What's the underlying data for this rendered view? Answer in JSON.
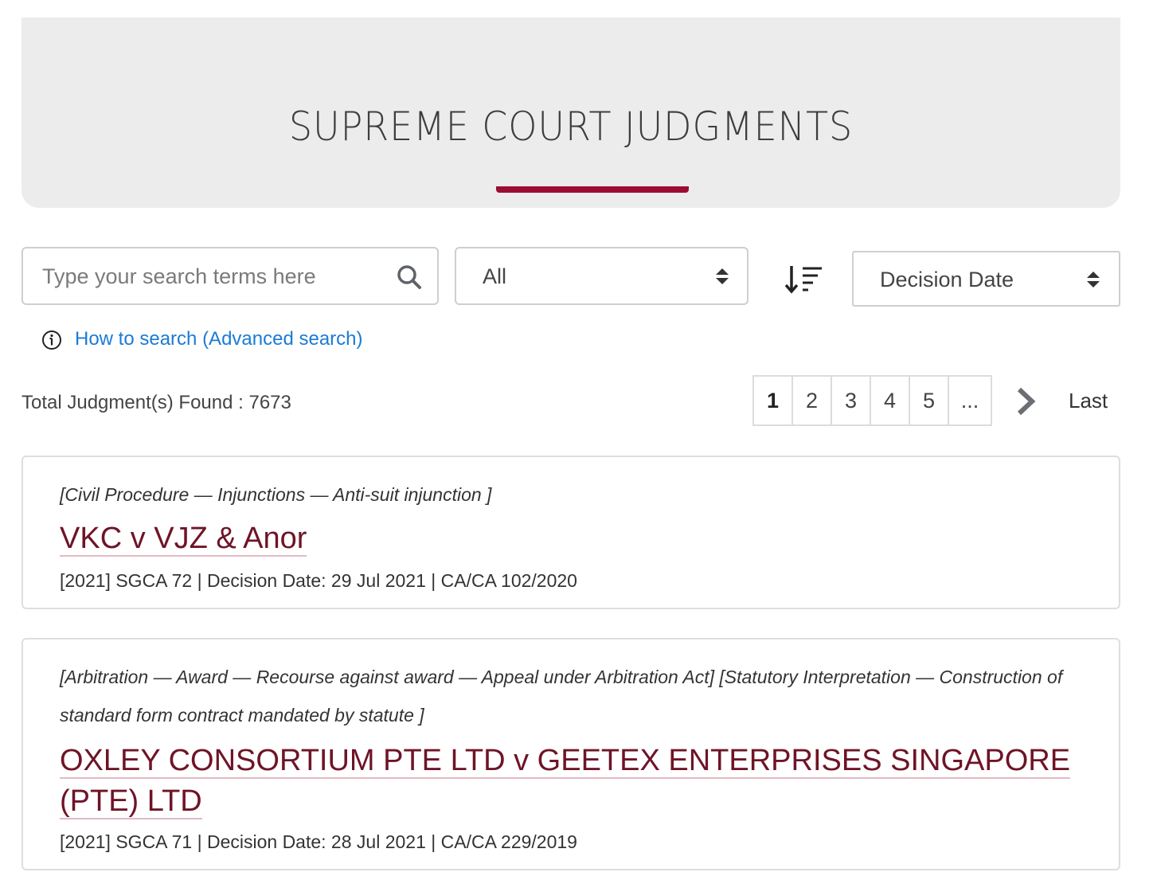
{
  "header": {
    "title": "SUPREME COURT JUDGMENTS",
    "accent_color": "#9b0d35"
  },
  "search": {
    "placeholder": "Type your search terms here",
    "value": "",
    "icon": "search-icon"
  },
  "filters": {
    "court_selected": "All",
    "sort_field_selected": "Decision Date",
    "sort_order_icon": "sort-descending-icon"
  },
  "help": {
    "link_label": "How to search (Advanced search)",
    "link_color": "#1a7bd6"
  },
  "results": {
    "total_label": "Total Judgment(s) Found : 7673"
  },
  "pagination": {
    "pages": [
      "1",
      "2",
      "3",
      "4",
      "5",
      "..."
    ],
    "current": "1",
    "last_label": "Last"
  },
  "judgments": [
    {
      "catchwords": "[Civil Procedure — Injunctions — Anti-suit injunction ]",
      "title": "VKC v VJZ & Anor",
      "meta": "[2021] SGCA 72 | Decision Date: 29 Jul 2021 | CA/CA 102/2020"
    },
    {
      "catchwords": "[Arbitration — Award — Recourse against award — Appeal under Arbitration Act] [Statutory Interpretation — Construction of standard form contract mandated by statute ]",
      "title": "OXLEY CONSORTIUM PTE LTD v GEETEX ENTERPRISES SINGAPORE (PTE) LTD",
      "meta": "[2021] SGCA 71 | Decision Date: 28 Jul 2021 | CA/CA 229/2019"
    }
  ],
  "colors": {
    "case_title": "#6e1426",
    "hero_background": "#ececec"
  }
}
